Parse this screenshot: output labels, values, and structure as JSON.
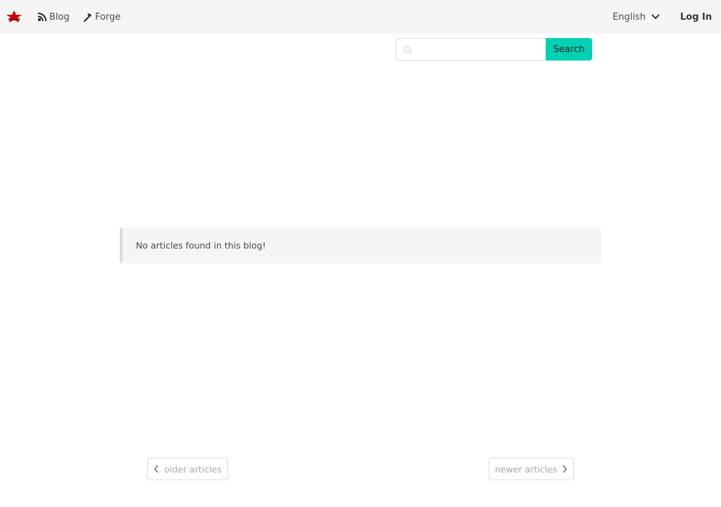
{
  "navbar": {
    "blog_label": "Blog",
    "forge_label": "Forge",
    "language_label": "English",
    "login_label": "Log In",
    "icons": {
      "brand": "red-ship-logo",
      "blog": "rss-feed-icon",
      "forge": "hammer-icon",
      "language": "chevron-down-icon"
    }
  },
  "search": {
    "placeholder": "",
    "value": "",
    "button_label": "Search",
    "icon": "search-icon"
  },
  "main": {
    "empty_message": "No articles found in this blog!"
  },
  "pagination": {
    "older_label": "older articles",
    "newer_label": "newer articles"
  },
  "colors": {
    "brand": "#cc0000",
    "accent": "#00d1b2",
    "navbar_bg": "#f5f5f5"
  }
}
